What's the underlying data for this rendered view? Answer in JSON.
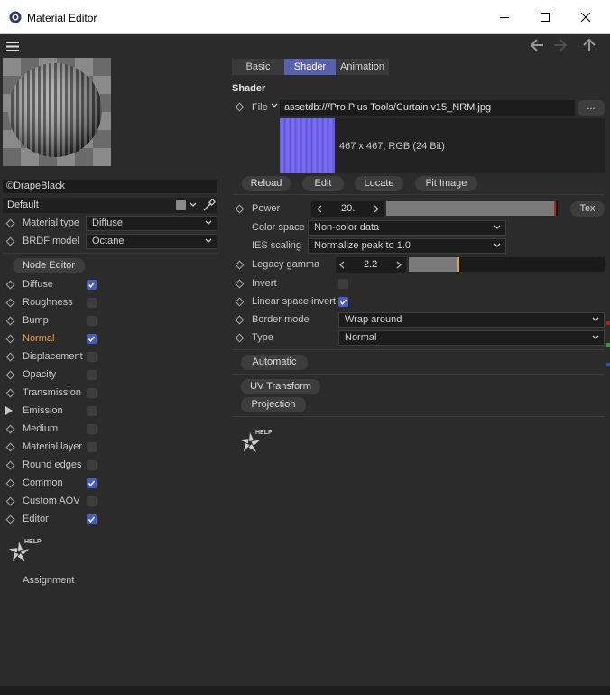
{
  "window": {
    "title": "Material Editor"
  },
  "left": {
    "material_name": "©DrapeBlack",
    "preset": "Default",
    "material_type": {
      "label": "Material type",
      "value": "Diffuse"
    },
    "brdf_model": {
      "label": "BRDF model",
      "value": "Octane"
    },
    "node_editor_label": "Node Editor",
    "channels": [
      {
        "label": "Diffuse",
        "checked": true,
        "highlight": false
      },
      {
        "label": "Roughness",
        "checked": false,
        "highlight": false
      },
      {
        "label": "Bump",
        "checked": false,
        "highlight": false
      },
      {
        "label": "Normal",
        "checked": true,
        "highlight": true
      },
      {
        "label": "Displacement",
        "checked": false,
        "highlight": false
      },
      {
        "label": "Opacity",
        "checked": false,
        "highlight": false
      },
      {
        "label": "Transmission",
        "checked": false,
        "highlight": false
      },
      {
        "label": "Emission",
        "checked": false,
        "highlight": false
      },
      {
        "label": "Medium",
        "checked": false,
        "highlight": false
      },
      {
        "label": "Material layer",
        "checked": false,
        "highlight": false
      },
      {
        "label": "Round edges",
        "checked": false,
        "highlight": false
      },
      {
        "label": "Common",
        "checked": true,
        "highlight": false
      },
      {
        "label": "Custom AOV",
        "checked": false,
        "highlight": false
      },
      {
        "label": "Editor",
        "checked": true,
        "highlight": false
      }
    ],
    "help_label": "HELP",
    "assignment_label": "Assignment"
  },
  "right": {
    "tabs": [
      {
        "label": "Basic",
        "active": false
      },
      {
        "label": "Shader",
        "active": true
      },
      {
        "label": "Animation",
        "active": false
      }
    ],
    "section_title": "Shader",
    "file": {
      "label": "File",
      "value": "assetdb:///Pro Plus Tools/Curtain v15_NRM.jpg",
      "browse_label": "..."
    },
    "texture_info": "467 x 467, RGB (24 Bit)",
    "buttons": {
      "reload": "Reload",
      "edit": "Edit",
      "locate": "Locate",
      "fit_image": "Fit Image"
    },
    "power": {
      "label": "Power",
      "value": "20.",
      "tex_label": "Tex",
      "slider_fraction": 0.99
    },
    "color_space": {
      "label": "Color space",
      "value": "Non-color data"
    },
    "ies_scaling": {
      "label": "IES scaling",
      "value": "Normalize peak to 1.0"
    },
    "legacy_gamma": {
      "label": "Legacy gamma",
      "value": "2.2",
      "slider_fraction": 0.26
    },
    "invert": {
      "label": "Invert",
      "checked": false
    },
    "linear_space_invert": {
      "label": "Linear space invert",
      "checked": true
    },
    "border_mode": {
      "label": "Border mode",
      "value": "Wrap around"
    },
    "type": {
      "label": "Type",
      "value": "Normal"
    },
    "automatic_label": "Automatic",
    "uv_transform_label": "UV Transform",
    "projection_label": "Projection",
    "help_label": "HELP"
  },
  "colors": {
    "accent": "#5961aa",
    "check": "#4a5bbf",
    "highlight": "#e8a24a",
    "power_marker": "#b3261e",
    "gamma_marker": "#e8a030"
  }
}
